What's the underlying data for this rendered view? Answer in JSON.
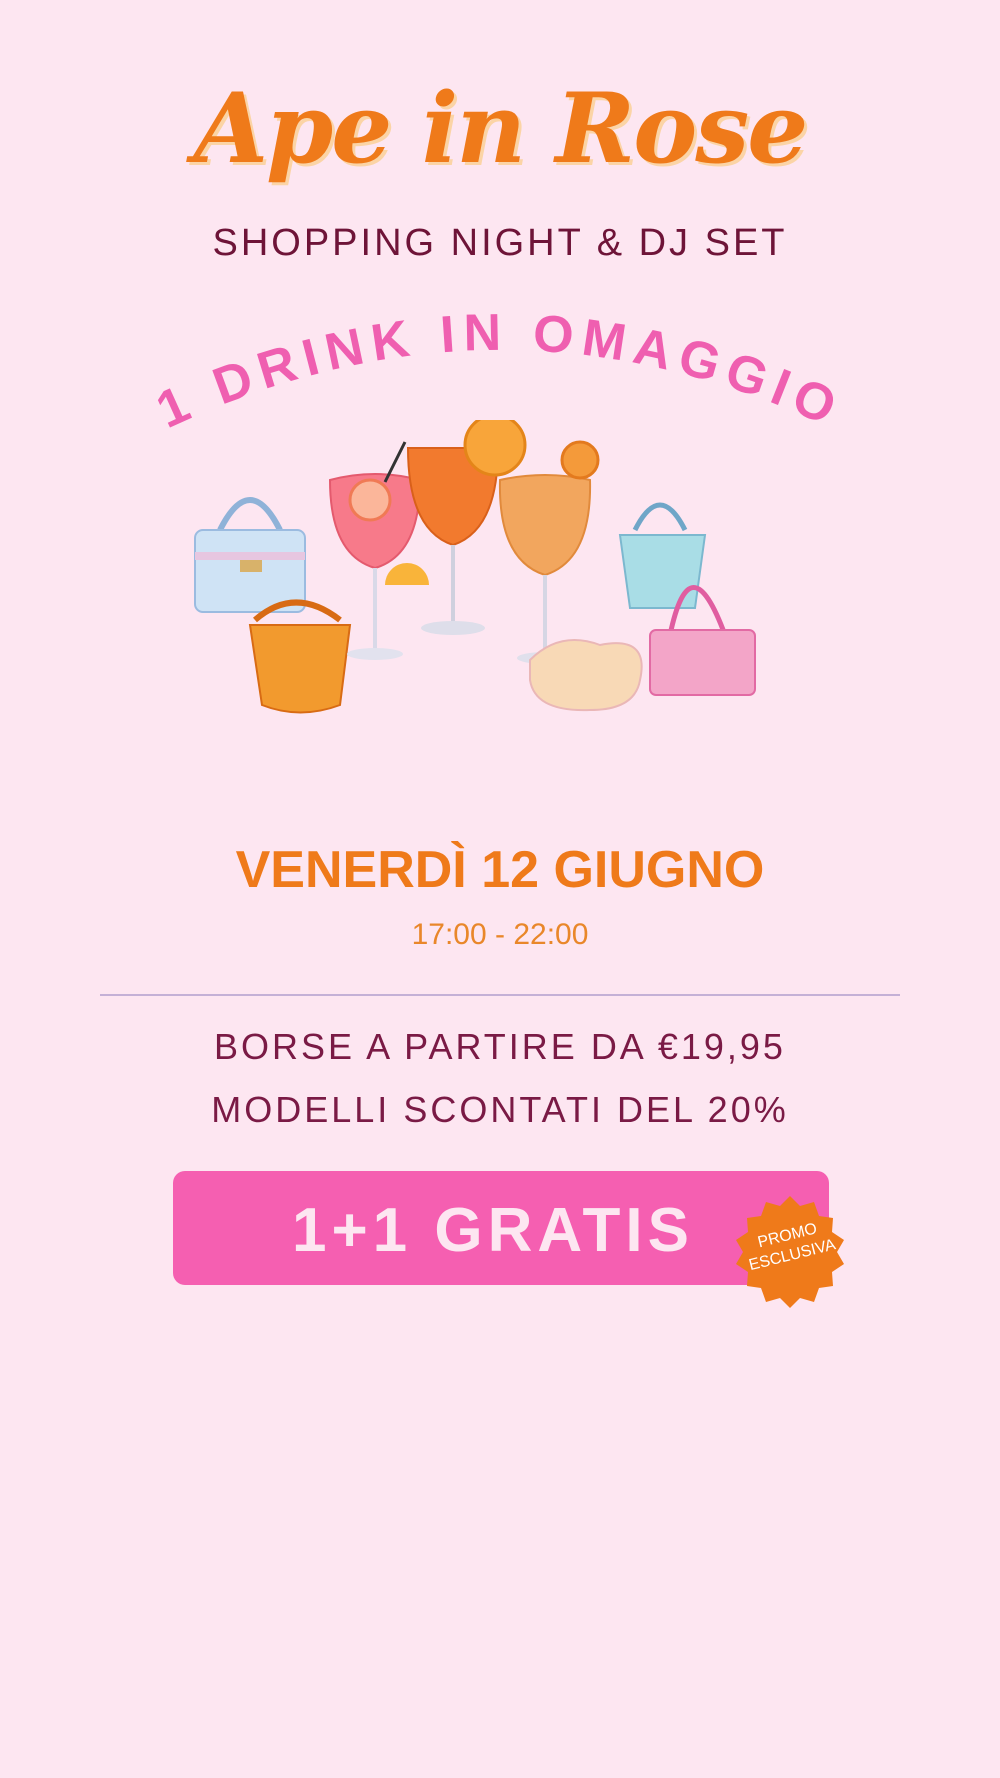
{
  "event": {
    "title": "Ape in Rose",
    "subtitle": "SHOPPING NIGHT & DJ SET",
    "arc_text": "1 DRINK IN OMAGGIO",
    "date": "VENERDÌ 12 GIUGNO",
    "time": "17:00 - 22:00"
  },
  "offers": {
    "line1": "BORSE A PARTIRE DA €19,95",
    "line2": "MODELLI SCONTATI DEL 20%"
  },
  "cta": {
    "label": "1+1 GRATIS",
    "badge_line1": "PROMO",
    "badge_line2": "ESCLUSIVA"
  },
  "colors": {
    "background": "#fde6f1",
    "orange": "#ef7a1a",
    "pink": "#f55fb1",
    "plum": "#7a1a45"
  }
}
